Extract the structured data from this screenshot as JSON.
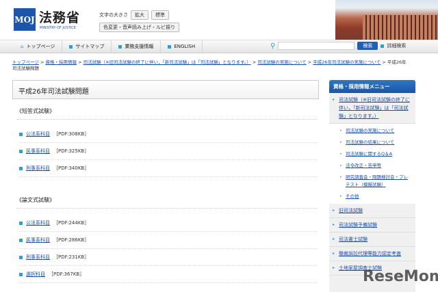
{
  "header": {
    "logo": "MOJ",
    "org_name": "法務省",
    "org_name_en": "MINISTRY OF JUSTICE",
    "font_size_label": "文字の大きさ",
    "enlarge": "拡大",
    "standard": "標準",
    "accessibility": "色変更・音声読み上げ・ルビ振り"
  },
  "nav": [
    "トップページ",
    "サイトマップ",
    "業務支援情報",
    "ENGLISH"
  ],
  "search": {
    "button": "検索",
    "advanced": "詳細検索"
  },
  "breadcrumb": [
    "トップページ",
    "資格・採用情報",
    "司法試験（※旧司法試験の終了に伴い，「新司法試験」は「司法試験」となります。）",
    "司法試験の実施について",
    "平成26年司法試験の実施について"
  ],
  "breadcrumb_current": "平成26年司法試験問題",
  "main": {
    "title": "平成26年司法試験問題",
    "sections": [
      {
        "heading": "《短答式試験》",
        "items": [
          {
            "label": "公法系科目",
            "size": "［PDF:308KB］"
          },
          {
            "label": "民事系科目",
            "size": "［PDF:325KB］"
          },
          {
            "label": "刑事系科目",
            "size": "［PDF:340KB］"
          }
        ]
      },
      {
        "heading": "《論文式試験》",
        "items": [
          {
            "label": "公法系科目",
            "size": "［PDF:244KB］"
          },
          {
            "label": "民事系科目",
            "size": "［PDF:286KB］"
          },
          {
            "label": "刑事系科目",
            "size": "［PDF:231KB］"
          },
          {
            "label": "選択科目",
            "size": "［PDF:367KB］"
          }
        ]
      }
    ]
  },
  "sidebar": {
    "title": "資格・採用情報メニュー",
    "top": "司法試験（※旧司法試験の終了に伴い，「新司法試験」は「司法試験」となります。）",
    "sub": [
      "司法試験の実施について",
      "司法試験の結果について",
      "司法試験に関するQ＆A",
      "法令改正・答申等",
      "研究調査会・問題検討会・プレテスト（模擬試験）",
      "その他"
    ],
    "others": [
      "旧司法試験",
      "司法試験予備試験",
      "司法書士試験",
      "簡裁訴訟代理等能力認定考査",
      "土地家屋調査士試験"
    ]
  },
  "watermark": "ReseMom"
}
